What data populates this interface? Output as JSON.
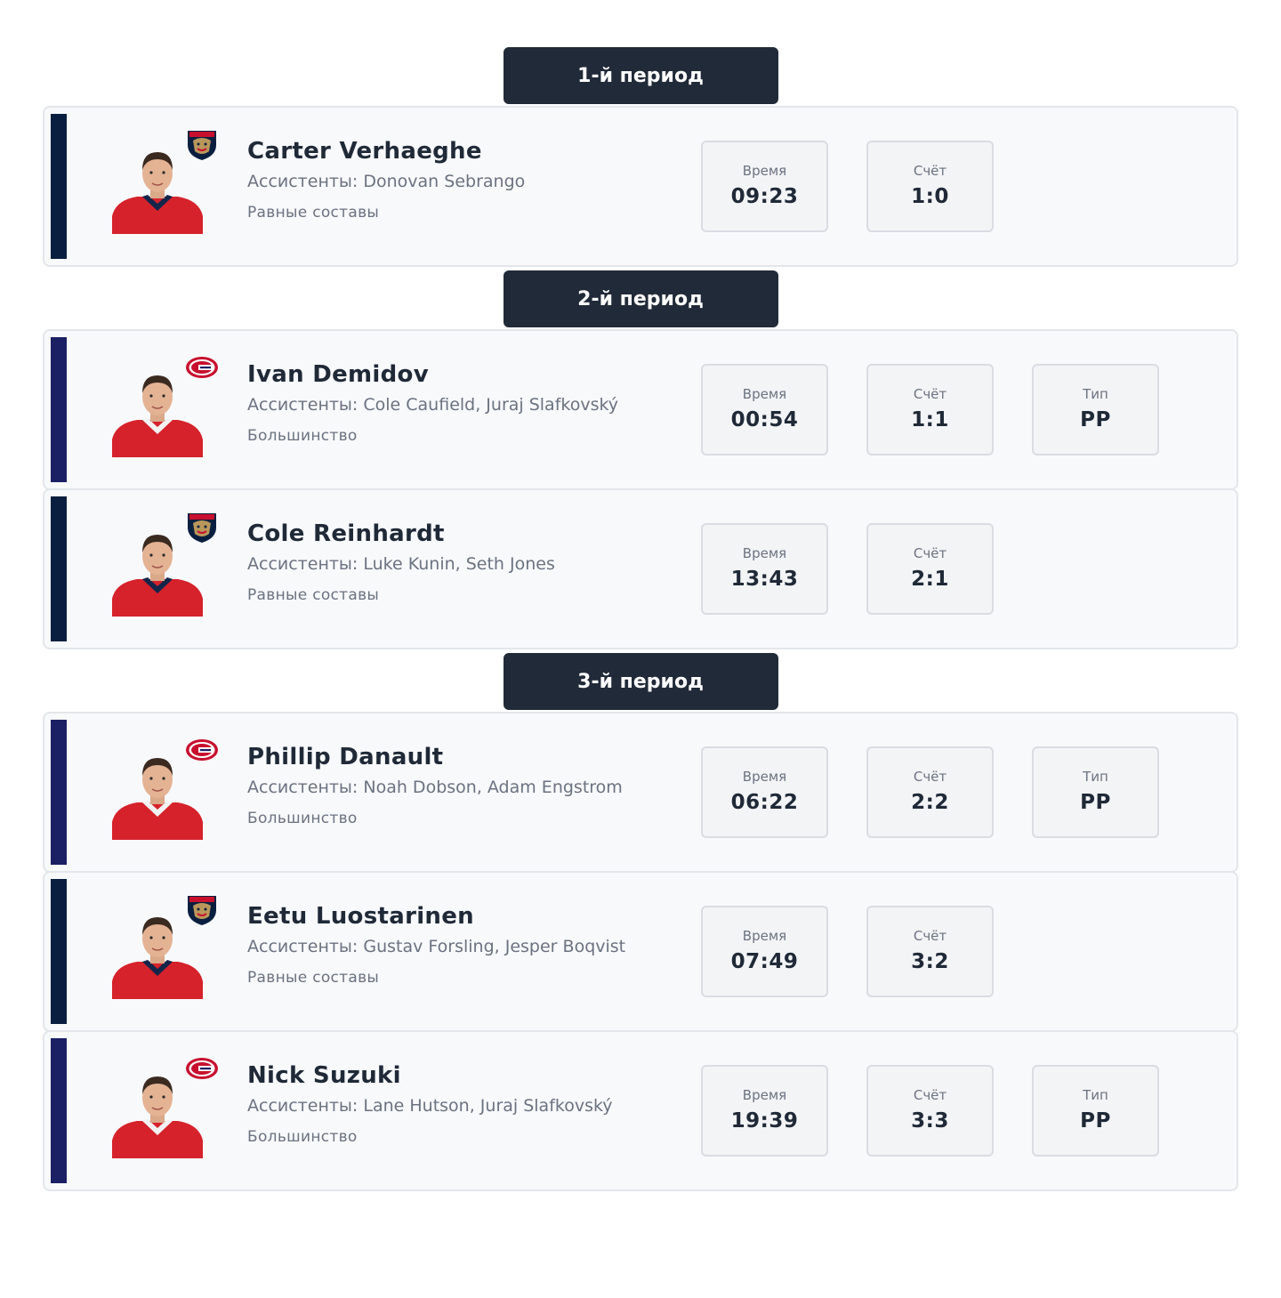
{
  "colors": {
    "header_bg": "#212a38",
    "panthers_accent": "#0a1f3f",
    "canadiens_accent": "#1b1f64",
    "jersey_red": "#d6222b"
  },
  "stat_labels": {
    "time": "Время",
    "score": "Счёт",
    "type": "Тип"
  },
  "periods": [
    {
      "title": "1-й период",
      "goals": [
        {
          "team": "panthers",
          "logo_icon": "florida-panthers-logo-icon",
          "player": "Carter Verhaeghe",
          "assists": "Ассистенты: Donovan Sebrango",
          "strength": "Равные составы",
          "time": "09:23",
          "score": "1:0",
          "type": null
        }
      ]
    },
    {
      "title": "2-й период",
      "goals": [
        {
          "team": "canadiens",
          "logo_icon": "montreal-canadiens-logo-icon",
          "player": "Ivan Demidov",
          "assists": "Ассистенты: Cole Caufield, Juraj Slafkovský",
          "strength": "Большинство",
          "time": "00:54",
          "score": "1:1",
          "type": "PP"
        },
        {
          "team": "panthers",
          "logo_icon": "florida-panthers-logo-icon",
          "player": "Cole Reinhardt",
          "assists": "Ассистенты: Luke Kunin, Seth Jones",
          "strength": "Равные составы",
          "time": "13:43",
          "score": "2:1",
          "type": null
        }
      ]
    },
    {
      "title": "3-й период",
      "goals": [
        {
          "team": "canadiens",
          "logo_icon": "montreal-canadiens-logo-icon",
          "player": "Phillip Danault",
          "assists": "Ассистенты: Noah Dobson, Adam Engstrom",
          "strength": "Большинство",
          "time": "06:22",
          "score": "2:2",
          "type": "PP"
        },
        {
          "team": "panthers",
          "logo_icon": "florida-panthers-logo-icon",
          "player": "Eetu Luostarinen",
          "assists": "Ассистенты: Gustav Forsling, Jesper Boqvist",
          "strength": "Равные составы",
          "time": "07:49",
          "score": "3:2",
          "type": null
        },
        {
          "team": "canadiens",
          "logo_icon": "montreal-canadiens-logo-icon",
          "player": "Nick Suzuki",
          "assists": "Ассистенты: Lane Hutson, Juraj Slafkovský",
          "strength": "Большинство",
          "time": "19:39",
          "score": "3:3",
          "type": "PP"
        }
      ]
    }
  ]
}
